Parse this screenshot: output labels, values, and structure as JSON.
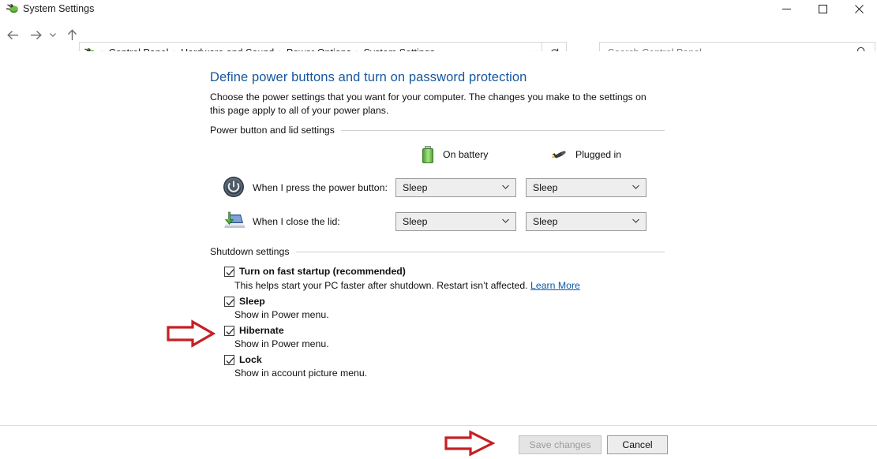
{
  "window": {
    "title": "System Settings",
    "icon": "control-panel-icon",
    "controls": {
      "minimize": "─",
      "maximize": "□",
      "close": "✕"
    }
  },
  "nav": {
    "back": "←",
    "forward": "→",
    "recent": "ⱽ",
    "up": "↑",
    "refresh": "↻",
    "dropdown": "ⱽ"
  },
  "breadcrumb": {
    "items": [
      "Control Panel",
      "Hardware and Sound",
      "Power Options",
      "System Settings"
    ],
    "separator": "›"
  },
  "search": {
    "placeholder": "Search Control Panel",
    "value": "",
    "icon": "search-icon"
  },
  "page": {
    "title": "Define power buttons and turn on password protection",
    "description": "Choose the power settings that you want for your computer. The changes you make to the settings on this page apply to all of your power plans."
  },
  "power_lid_section": {
    "heading": "Power button and lid settings",
    "columns": [
      {
        "label": "On battery",
        "icon": "battery-icon"
      },
      {
        "label": "Plugged in",
        "icon": "power-plug-icon"
      }
    ],
    "rows": [
      {
        "icon": "power-button-icon",
        "label": "When I press the power button:",
        "on_battery": "Sleep",
        "plugged_in": "Sleep"
      },
      {
        "icon": "laptop-lid-icon",
        "label": "When I close the lid:",
        "on_battery": "Sleep",
        "plugged_in": "Sleep"
      }
    ]
  },
  "shutdown_section": {
    "heading": "Shutdown settings",
    "items": [
      {
        "label": "Turn on fast startup (recommended)",
        "checked": true,
        "sub": "This helps start your PC faster after shutdown. Restart isn’t affected.",
        "link": "Learn More"
      },
      {
        "label": "Sleep",
        "checked": true,
        "sub": "Show in Power menu.",
        "link": ""
      },
      {
        "label": "Hibernate",
        "checked": true,
        "sub": "Show in Power menu.",
        "link": ""
      },
      {
        "label": "Lock",
        "checked": true,
        "sub": "Show in account picture menu.",
        "link": ""
      }
    ]
  },
  "footer": {
    "save_label": "Save changes",
    "save_enabled": false,
    "cancel_label": "Cancel"
  },
  "annotations": {
    "color": "#c62024",
    "arrows": [
      {
        "name": "hibernate-pointer-arrow"
      },
      {
        "name": "save-changes-pointer-arrow"
      }
    ]
  }
}
